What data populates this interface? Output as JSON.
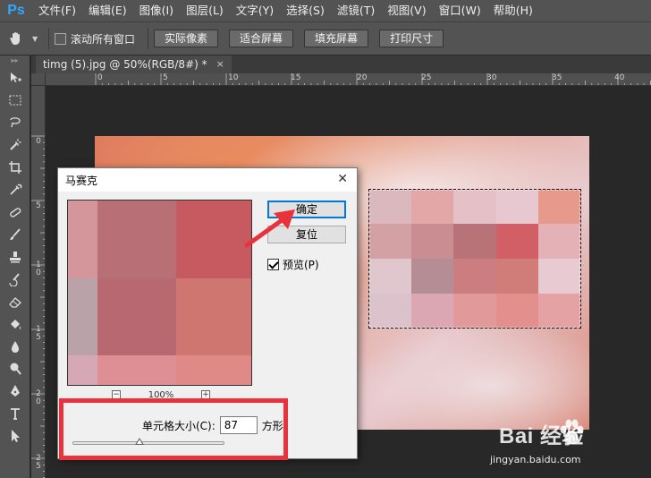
{
  "app": {
    "logo": "Ps",
    "menu": [
      "文件(F)",
      "编辑(E)",
      "图像(I)",
      "图层(L)",
      "文字(Y)",
      "选择(S)",
      "滤镜(T)",
      "视图(V)",
      "窗口(W)",
      "帮助(H)"
    ]
  },
  "options_bar": {
    "scroll_all_label": "滚动所有窗口",
    "buttons": [
      "实际像素",
      "适合屏幕",
      "填充屏幕",
      "打印尺寸"
    ]
  },
  "document": {
    "tab_title": "timg (5).jpg @ 50%(RGB/8#) *",
    "close_glyph": "×"
  },
  "rulers": {
    "h_labels": [
      "0",
      "5",
      "10",
      "15",
      "20",
      "25",
      "30",
      "35",
      "40"
    ],
    "v_labels": [
      "0",
      "5",
      "1\n0",
      "1\n5",
      "2\n0",
      "2\n5"
    ]
  },
  "dialog": {
    "title": "马赛克",
    "close_glyph": "✕",
    "ok_label": "确定",
    "reset_label": "复位",
    "preview_label": "预览(P)",
    "preview_checked": true,
    "zoom_minus": "−",
    "zoom_plus": "+",
    "zoom_level": "100%",
    "cell_size_label": "单元格大小(C):",
    "cell_size_value": "87",
    "cell_size_unit": "方形",
    "slider_fraction": 0.44
  },
  "colors": {
    "annotation_red": "#e8323c",
    "preview_cells": [
      "#d4969a",
      "#b86f76",
      "#c65a60",
      "#b9a2a8",
      "#b86870",
      "#cf7670",
      "#d6a8b6",
      "#de8f93",
      "#e08a87"
    ],
    "mosaic_cells": [
      "#dbb8be",
      "#e4a7a8",
      "#e6c0c7",
      "#e8c8d0",
      "#e79a8c",
      "#d3a0a4",
      "#c98d92",
      "#b87379",
      "#d25f66",
      "#e3b1b6",
      "#dfc7cd",
      "#b58e95",
      "#cc7d80",
      "#d07d7a",
      "#e8cbd2",
      "#dcc2ca",
      "#dba7b2",
      "#e29999",
      "#e28f8e",
      "#e4a2a4"
    ]
  },
  "watermark": {
    "logo_text": "Bai 经验",
    "url": "jingyan.baidu.com"
  }
}
